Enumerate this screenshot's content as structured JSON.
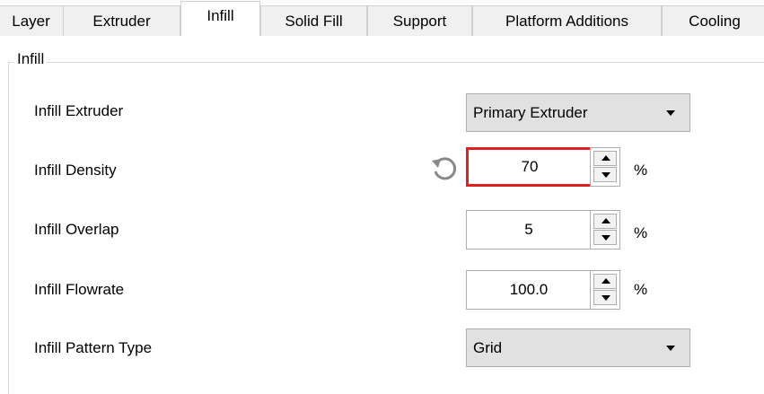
{
  "tabs": [
    {
      "label": "Layer",
      "active": false
    },
    {
      "label": "Extruder",
      "active": false
    },
    {
      "label": "Infill",
      "active": true
    },
    {
      "label": "Solid Fill",
      "active": false
    },
    {
      "label": "Support",
      "active": false
    },
    {
      "label": "Platform Additions",
      "active": false
    },
    {
      "label": "Cooling",
      "active": false
    }
  ],
  "group": {
    "title": "Infill"
  },
  "fields": {
    "extruder": {
      "label": "Infill Extruder",
      "value": "Primary Extruder"
    },
    "density": {
      "label": "Infill Density",
      "value": "70",
      "unit": "%",
      "reset_icon": "reset-icon"
    },
    "overlap": {
      "label": "Infill Overlap",
      "value": "5",
      "unit": "%"
    },
    "flowrate": {
      "label": "Infill Flowrate",
      "value": "100.0",
      "unit": "%"
    },
    "pattern": {
      "label": "Infill Pattern Type",
      "value": "Grid"
    }
  },
  "colors": {
    "focus_border": "#e02020",
    "combo_bg": "#e1e1e1",
    "tab_bg": "#f0f0f0"
  }
}
